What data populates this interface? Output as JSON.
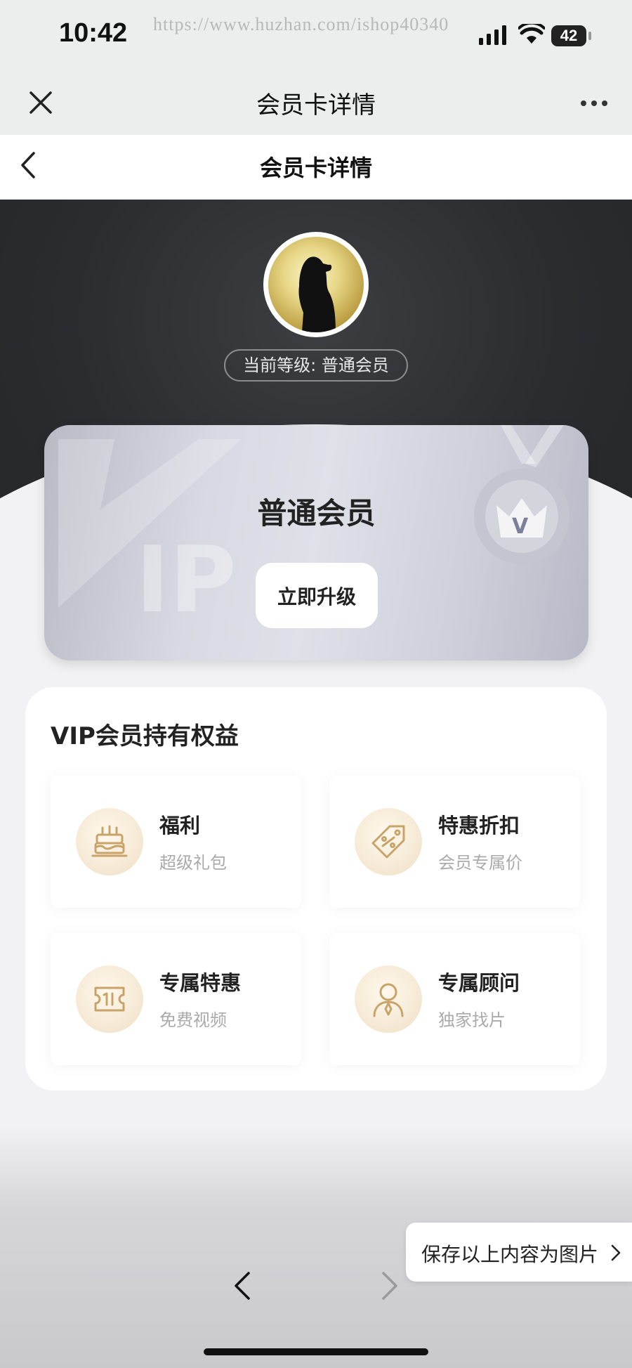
{
  "status_bar": {
    "time": "10:42",
    "watermark": "https://www.huzhan.com/ishop40340",
    "battery": "42"
  },
  "outer_nav": {
    "title": "会员卡详情"
  },
  "inner_nav": {
    "title": "会员卡详情"
  },
  "profile": {
    "level_text": "当前等级: 普通会员"
  },
  "card": {
    "name": "普通会员",
    "upgrade_label": "立即升级",
    "watermark": "VIP"
  },
  "benefits": {
    "heading": "VIP会员持有权益",
    "items": [
      {
        "title": "福利",
        "subtitle": "超级礼包",
        "icon": "cake-icon"
      },
      {
        "title": "特惠折扣",
        "subtitle": "会员专属价",
        "icon": "discount-tag-icon"
      },
      {
        "title": "专属特惠",
        "subtitle": "免费视频",
        "icon": "ticket-icon"
      },
      {
        "title": "专属顾问",
        "subtitle": "独家找片",
        "icon": "advisor-icon"
      }
    ]
  },
  "footer": {
    "save_label": "保存以上内容为图片"
  },
  "colors": {
    "hero_bg": "#2a2c2f",
    "gold_icon": "#c9a46a",
    "card_silver": "#d8d9e2"
  }
}
